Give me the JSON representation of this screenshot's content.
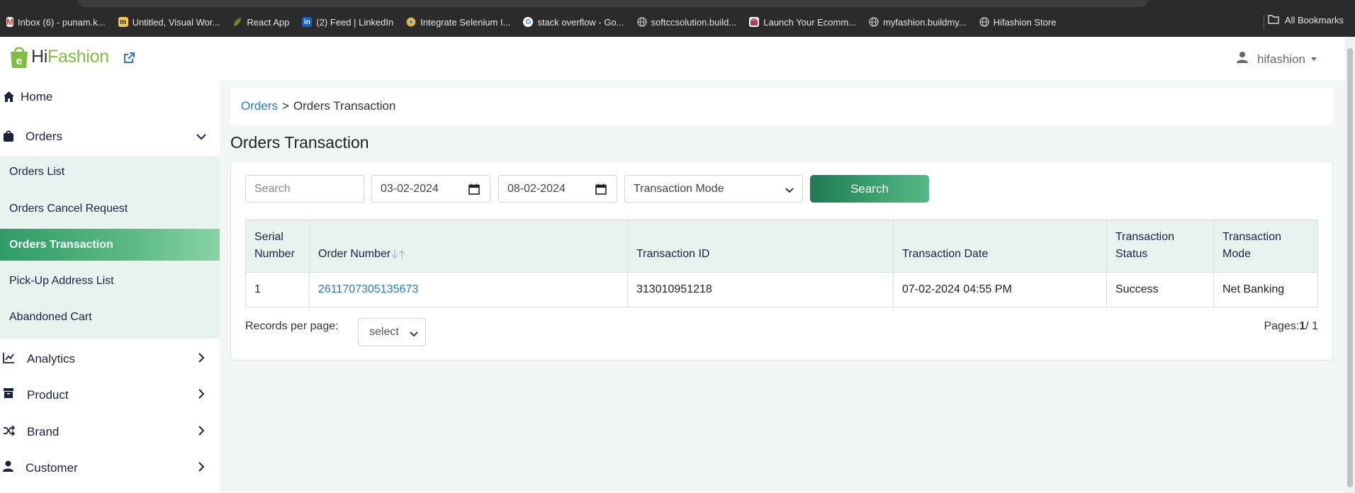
{
  "browser": {
    "bookmarks": [
      {
        "label": "Inbox (6) - punam.k...",
        "icon": "gmail-icon",
        "color": "#d93025"
      },
      {
        "label": "Untitled, Visual Wor...",
        "icon": "miro-icon",
        "color": "#f2c94c"
      },
      {
        "label": "React App",
        "icon": "leaf-icon",
        "color": "#5c8a2b"
      },
      {
        "label": "(2) Feed | LinkedIn",
        "icon": "linkedin-icon",
        "color": "#0a66c2"
      },
      {
        "label": "Integrate Selenium I...",
        "icon": "chrome-icon",
        "color": "#e0a81f"
      },
      {
        "label": "stack overflow - Go...",
        "icon": "google-icon",
        "color": "#4285f4"
      },
      {
        "label": "softccsolution.build...",
        "icon": "globe-icon",
        "color": "#8a8a8a"
      },
      {
        "label": "Launch Your Ecomm...",
        "icon": "store-icon",
        "color": "#b03a6a"
      },
      {
        "label": "myfashion.buildmy...",
        "icon": "globe-icon",
        "color": "#8a8a8a"
      },
      {
        "label": "Hifashion Store",
        "icon": "globe-icon",
        "color": "#8a8a8a"
      }
    ],
    "all_bookmarks": "All Bookmarks"
  },
  "header": {
    "logo_prefix": "Hi",
    "logo_suffix": "Fashion",
    "username": "hifashion"
  },
  "sidebar": {
    "home": "Home",
    "orders": "Orders",
    "orders_sub": [
      "Orders List",
      "Orders Cancel Request",
      "Orders Transaction",
      "Pick-Up Address List",
      "Abandoned Cart"
    ],
    "analytics": "Analytics",
    "product": "Product",
    "brand": "Brand",
    "customer": "Customer"
  },
  "breadcrumb": {
    "parent": "Orders",
    "separator": ">",
    "current": "Orders Transaction"
  },
  "page_title": "Orders Transaction",
  "filters": {
    "search_placeholder": "Search",
    "from_date": "03-02-2024",
    "to_date": "08-02-2024",
    "mode_selected": "Transaction Mode",
    "search_button": "Search"
  },
  "table": {
    "headers": {
      "serial": [
        "Serial",
        "Number"
      ],
      "order_number": "Order Number",
      "transaction_id": "Transaction ID",
      "transaction_date": "Transaction Date",
      "status": [
        "Transaction",
        "Status"
      ],
      "mode": [
        "Transaction",
        "Mode"
      ]
    },
    "rows": [
      {
        "serial": "1",
        "order_number": "2611707305135673",
        "transaction_id": "313010951218",
        "transaction_date": "07-02-2024 04:55 PM",
        "status": "Success",
        "mode": "Net Banking"
      }
    ]
  },
  "pagination": {
    "records_label": "Records per page:",
    "records_select": "select",
    "pages_label": "Pages:",
    "current_page": "1",
    "total_pages": "/ 1"
  },
  "colors": {
    "accent_green": "#3fa471",
    "link_blue": "#2a78c8",
    "logo_green": "#7cbf3d"
  }
}
